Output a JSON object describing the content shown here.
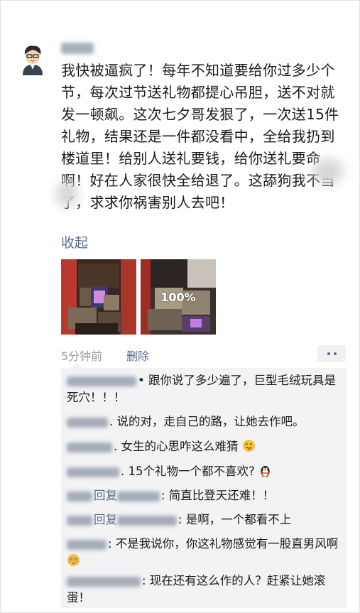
{
  "post": {
    "author_avatar_icon": "cartoon-boy-avatar-icon",
    "text": "我快被逼疯了！每年不知道要给你过多少个节，每次过节送礼物都提心吊胆，送不对就发一顿飙。这次七夕哥发狠了，一次送15件礼物，结果还是一件都没看中，全给我扔到楼道里！给别人送礼要钱，给你送礼要命啊！好在人家很快全给退了。这舔狗我不当了，求求你祸害别人去吧！",
    "collapse_label": "收起",
    "photos": [
      {
        "name": "gifts-photo-1"
      },
      {
        "name": "gifts-photo-2",
        "overlay_text": "100%"
      }
    ],
    "time": "5分钟前",
    "delete_label": "删除"
  },
  "comments": [
    {
      "reply_label": "",
      "text": "• 跟你说了多少遍了，巨型毛绒玩具是死穴！！！"
    },
    {
      "reply_label": "",
      "text": ". 说的对，走自己的路，让她去作吧。"
    },
    {
      "reply_label": "",
      "text": ". 女生的心思咋这么难猜",
      "emoji": "wink-tongue-emoji"
    },
    {
      "reply_label": "",
      "text": ". 15个礼物一个都不喜欢?",
      "emoji": "qq-penguin-emoji"
    },
    {
      "reply_label": "回复",
      "text": ": 简直比登天还难！！"
    },
    {
      "reply_label": "回复",
      "text": ": 是啊，一个都看不上"
    },
    {
      "reply_label": "",
      "text": ": 不是我说你，你这礼物感觉有一股直男风啊",
      "emoji": "flushed-face-emoji"
    },
    {
      "reply_label": "",
      "text": ": 现在还有这么作的人？赶紧让她滚蛋！"
    }
  ]
}
